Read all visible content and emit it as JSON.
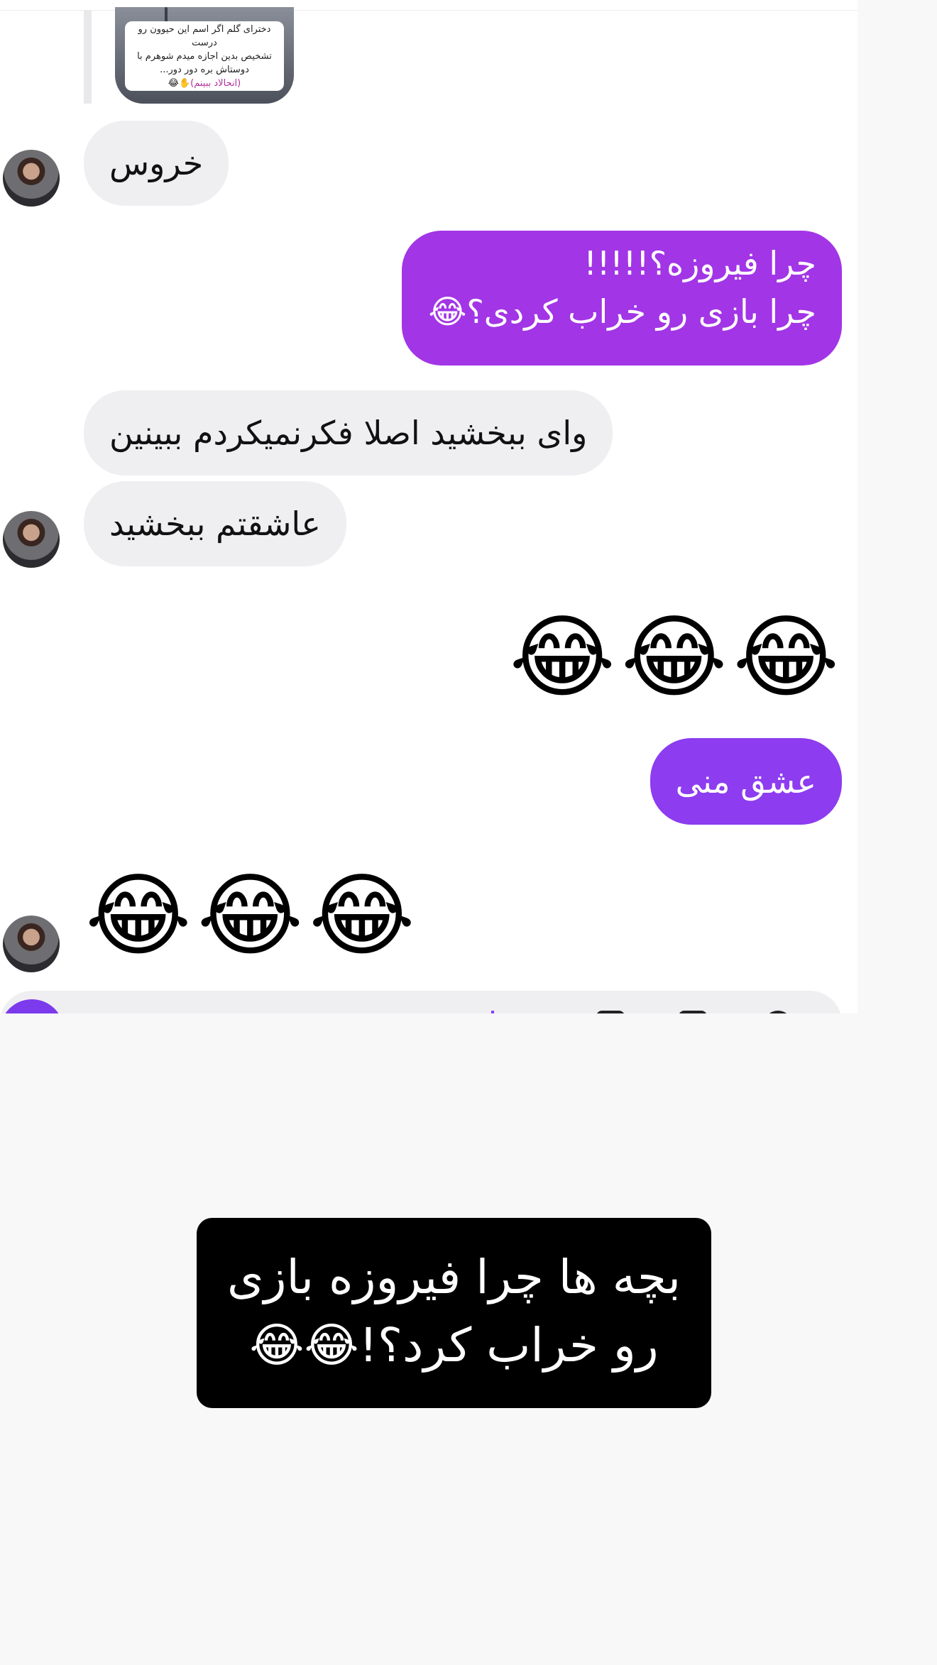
{
  "story_reply": {
    "line1": "دخترای گلم اگر اسم این حیوون رو درست",
    "line2": "تشخیص بدین اجازه میدم شوهرم با",
    "line3": "دوستاش بره دور دور...",
    "line4_prefix": "✋😂",
    "line4_highlight": "(انحالاد ببینم)"
  },
  "messages": [
    {
      "id": "m1",
      "side": "in",
      "text": "خروس"
    },
    {
      "id": "m2",
      "side": "out",
      "lines": [
        "چرا فیروزه؟!!!!!",
        "چرا بازی رو خراب کردی؟😂"
      ]
    },
    {
      "id": "m3",
      "side": "in",
      "text": "وای ببخشید اصلا فکرنمیکردم ببینین"
    },
    {
      "id": "m4",
      "side": "in",
      "text": "عاشقتم ببخشید"
    },
    {
      "id": "m5",
      "side": "out",
      "emoji": "😂😂😂"
    },
    {
      "id": "m6",
      "side": "out",
      "text": "عشق منی"
    },
    {
      "id": "m7",
      "side": "in",
      "emoji": "😂😂😂"
    }
  ],
  "caption": {
    "line1": "بچه ها چرا فیروزه بازی",
    "line2": "رو خراب کرد؟!😂😂"
  },
  "colors": {
    "incoming_bubble": "#efeff2",
    "outgoing_bubble_1": "#a235e6",
    "outgoing_bubble_2": "#8d3cf0",
    "caption_bg": "#000000",
    "page_bg": "#f8f8f8"
  }
}
